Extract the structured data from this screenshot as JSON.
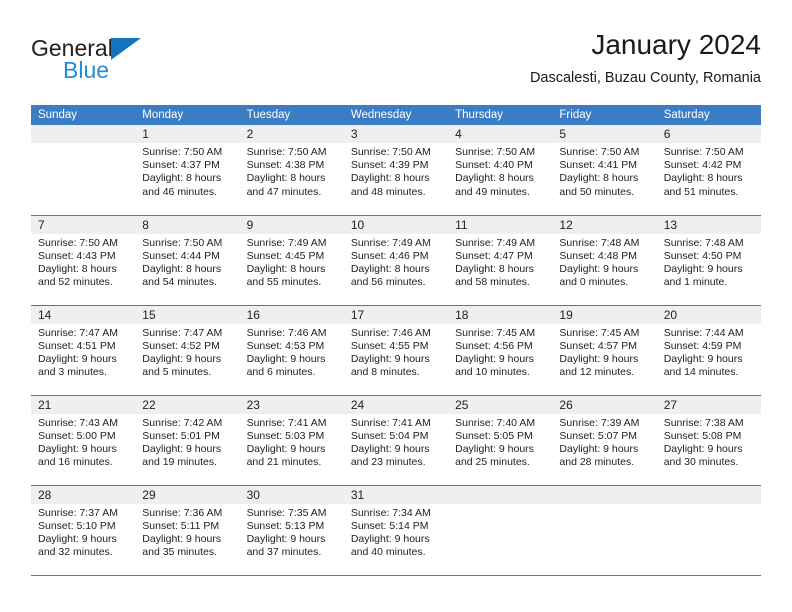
{
  "brand": {
    "name_part1": "General",
    "name_part2": "Blue",
    "color_dark": "#231f20",
    "color_blue": "#1f8ddb"
  },
  "header": {
    "title": "January 2024",
    "subtitle": "Dascalesti, Buzau County, Romania"
  },
  "theme": {
    "header_blue": "#3b7dc4",
    "daynum_band": "#efefef",
    "text": "#222222"
  },
  "weekdays": [
    "Sunday",
    "Monday",
    "Tuesday",
    "Wednesday",
    "Thursday",
    "Friday",
    "Saturday"
  ],
  "weeks": [
    [
      {
        "day": "",
        "lines": []
      },
      {
        "day": "1",
        "lines": [
          "Sunrise: 7:50 AM",
          "Sunset: 4:37 PM",
          "Daylight: 8 hours",
          "and 46 minutes."
        ]
      },
      {
        "day": "2",
        "lines": [
          "Sunrise: 7:50 AM",
          "Sunset: 4:38 PM",
          "Daylight: 8 hours",
          "and 47 minutes."
        ]
      },
      {
        "day": "3",
        "lines": [
          "Sunrise: 7:50 AM",
          "Sunset: 4:39 PM",
          "Daylight: 8 hours",
          "and 48 minutes."
        ]
      },
      {
        "day": "4",
        "lines": [
          "Sunrise: 7:50 AM",
          "Sunset: 4:40 PM",
          "Daylight: 8 hours",
          "and 49 minutes."
        ]
      },
      {
        "day": "5",
        "lines": [
          "Sunrise: 7:50 AM",
          "Sunset: 4:41 PM",
          "Daylight: 8 hours",
          "and 50 minutes."
        ]
      },
      {
        "day": "6",
        "lines": [
          "Sunrise: 7:50 AM",
          "Sunset: 4:42 PM",
          "Daylight: 8 hours",
          "and 51 minutes."
        ]
      }
    ],
    [
      {
        "day": "7",
        "lines": [
          "Sunrise: 7:50 AM",
          "Sunset: 4:43 PM",
          "Daylight: 8 hours",
          "and 52 minutes."
        ]
      },
      {
        "day": "8",
        "lines": [
          "Sunrise: 7:50 AM",
          "Sunset: 4:44 PM",
          "Daylight: 8 hours",
          "and 54 minutes."
        ]
      },
      {
        "day": "9",
        "lines": [
          "Sunrise: 7:49 AM",
          "Sunset: 4:45 PM",
          "Daylight: 8 hours",
          "and 55 minutes."
        ]
      },
      {
        "day": "10",
        "lines": [
          "Sunrise: 7:49 AM",
          "Sunset: 4:46 PM",
          "Daylight: 8 hours",
          "and 56 minutes."
        ]
      },
      {
        "day": "11",
        "lines": [
          "Sunrise: 7:49 AM",
          "Sunset: 4:47 PM",
          "Daylight: 8 hours",
          "and 58 minutes."
        ]
      },
      {
        "day": "12",
        "lines": [
          "Sunrise: 7:48 AM",
          "Sunset: 4:48 PM",
          "Daylight: 9 hours",
          "and 0 minutes."
        ]
      },
      {
        "day": "13",
        "lines": [
          "Sunrise: 7:48 AM",
          "Sunset: 4:50 PM",
          "Daylight: 9 hours",
          "and 1 minute."
        ]
      }
    ],
    [
      {
        "day": "14",
        "lines": [
          "Sunrise: 7:47 AM",
          "Sunset: 4:51 PM",
          "Daylight: 9 hours",
          "and 3 minutes."
        ]
      },
      {
        "day": "15",
        "lines": [
          "Sunrise: 7:47 AM",
          "Sunset: 4:52 PM",
          "Daylight: 9 hours",
          "and 5 minutes."
        ]
      },
      {
        "day": "16",
        "lines": [
          "Sunrise: 7:46 AM",
          "Sunset: 4:53 PM",
          "Daylight: 9 hours",
          "and 6 minutes."
        ]
      },
      {
        "day": "17",
        "lines": [
          "Sunrise: 7:46 AM",
          "Sunset: 4:55 PM",
          "Daylight: 9 hours",
          "and 8 minutes."
        ]
      },
      {
        "day": "18",
        "lines": [
          "Sunrise: 7:45 AM",
          "Sunset: 4:56 PM",
          "Daylight: 9 hours",
          "and 10 minutes."
        ]
      },
      {
        "day": "19",
        "lines": [
          "Sunrise: 7:45 AM",
          "Sunset: 4:57 PM",
          "Daylight: 9 hours",
          "and 12 minutes."
        ]
      },
      {
        "day": "20",
        "lines": [
          "Sunrise: 7:44 AM",
          "Sunset: 4:59 PM",
          "Daylight: 9 hours",
          "and 14 minutes."
        ]
      }
    ],
    [
      {
        "day": "21",
        "lines": [
          "Sunrise: 7:43 AM",
          "Sunset: 5:00 PM",
          "Daylight: 9 hours",
          "and 16 minutes."
        ]
      },
      {
        "day": "22",
        "lines": [
          "Sunrise: 7:42 AM",
          "Sunset: 5:01 PM",
          "Daylight: 9 hours",
          "and 19 minutes."
        ]
      },
      {
        "day": "23",
        "lines": [
          "Sunrise: 7:41 AM",
          "Sunset: 5:03 PM",
          "Daylight: 9 hours",
          "and 21 minutes."
        ]
      },
      {
        "day": "24",
        "lines": [
          "Sunrise: 7:41 AM",
          "Sunset: 5:04 PM",
          "Daylight: 9 hours",
          "and 23 minutes."
        ]
      },
      {
        "day": "25",
        "lines": [
          "Sunrise: 7:40 AM",
          "Sunset: 5:05 PM",
          "Daylight: 9 hours",
          "and 25 minutes."
        ]
      },
      {
        "day": "26",
        "lines": [
          "Sunrise: 7:39 AM",
          "Sunset: 5:07 PM",
          "Daylight: 9 hours",
          "and 28 minutes."
        ]
      },
      {
        "day": "27",
        "lines": [
          "Sunrise: 7:38 AM",
          "Sunset: 5:08 PM",
          "Daylight: 9 hours",
          "and 30 minutes."
        ]
      }
    ],
    [
      {
        "day": "28",
        "lines": [
          "Sunrise: 7:37 AM",
          "Sunset: 5:10 PM",
          "Daylight: 9 hours",
          "and 32 minutes."
        ]
      },
      {
        "day": "29",
        "lines": [
          "Sunrise: 7:36 AM",
          "Sunset: 5:11 PM",
          "Daylight: 9 hours",
          "and 35 minutes."
        ]
      },
      {
        "day": "30",
        "lines": [
          "Sunrise: 7:35 AM",
          "Sunset: 5:13 PM",
          "Daylight: 9 hours",
          "and 37 minutes."
        ]
      },
      {
        "day": "31",
        "lines": [
          "Sunrise: 7:34 AM",
          "Sunset: 5:14 PM",
          "Daylight: 9 hours",
          "and 40 minutes."
        ]
      },
      {
        "day": "",
        "lines": []
      },
      {
        "day": "",
        "lines": []
      },
      {
        "day": "",
        "lines": []
      }
    ]
  ]
}
